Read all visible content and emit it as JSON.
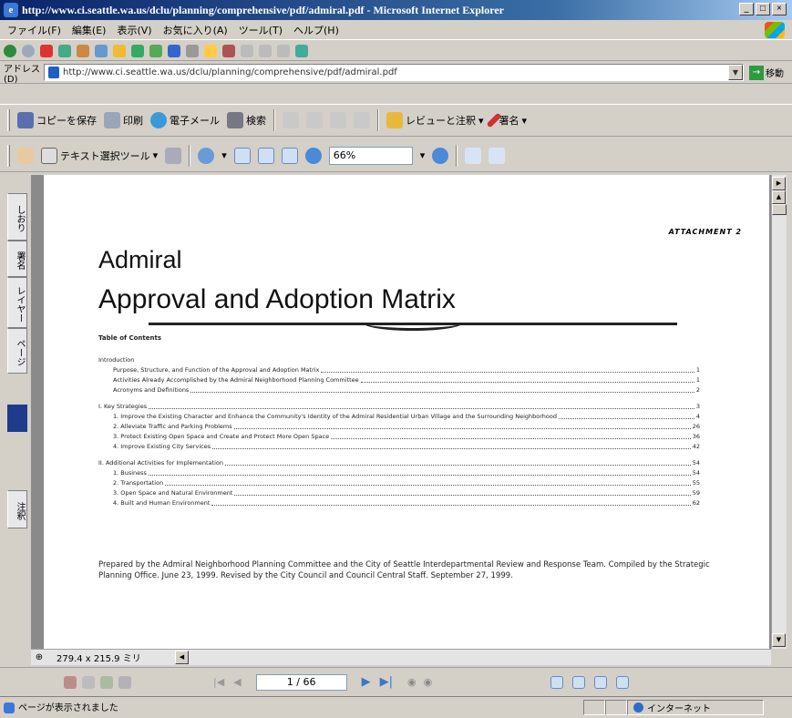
{
  "window": {
    "title": "http://www.ci.seattle.wa.us/dclu/planning/comprehensive/pdf/admiral.pdf - Microsoft Internet Explorer"
  },
  "menu": [
    "ファイル(F)",
    "編集(E)",
    "表示(V)",
    "お気に入り(A)",
    "ツール(T)",
    "ヘルプ(H)"
  ],
  "address": {
    "label": "アドレス(D)",
    "url": "http://www.ci.seattle.wa.us/dclu/planning/comprehensive/pdf/admiral.pdf",
    "go": "移動"
  },
  "toolbar1": {
    "save": "コピーを保存",
    "print": "印刷",
    "email": "電子メール",
    "search": "検索",
    "review": "レビューと注釈",
    "sign": "署名"
  },
  "toolbar2": {
    "select_text": "テキスト選択ツール",
    "zoom": "66%"
  },
  "side_tabs": {
    "bookmarks": "しおり",
    "signatures": "署名",
    "layers": "レイヤー",
    "pages": "ページ",
    "comments": "注釈"
  },
  "document": {
    "attachment": "ATTACHMENT 2",
    "title1": "Admiral",
    "title2": "Approval and Adoption Matrix",
    "toc_title": "Table of Contents",
    "intro": {
      "label": "Introduction",
      "items": [
        {
          "text": "Purpose, Structure, and Function of the Approval and Adoption Matrix",
          "page": "1"
        },
        {
          "text": "Activities Already Accomplished by the Admiral Neighborhood Planning Committee",
          "page": "1"
        },
        {
          "text": "Acronyms and Definitions",
          "page": "2"
        }
      ]
    },
    "key": {
      "label": "I. Key Strategies",
      "page": "3",
      "items": [
        {
          "text": "1. Improve the Existing Character and Enhance the Community's Identity of the Admiral Residential Urban Village and the Surrounding Neighborhood",
          "page": "4"
        },
        {
          "text": "2. Alleviate Traffic and Parking Problems",
          "page": "26"
        },
        {
          "text": "3. Protect Existing Open Space and Create and Protect More Open Space",
          "page": "36"
        },
        {
          "text": "4. Improve Existing City Services",
          "page": "42"
        }
      ]
    },
    "additional": {
      "label": "II. Additional Activities for Implementation",
      "page": "54",
      "items": [
        {
          "text": "1. Business",
          "page": "54"
        },
        {
          "text": "2. Transportation",
          "page": "55"
        },
        {
          "text": "3. Open Space and Natural Environment",
          "page": "59"
        },
        {
          "text": "4. Built and Human Environment",
          "page": "62"
        }
      ]
    },
    "prepared": "Prepared by the Admiral Neighborhood Planning Committee and the City of Seattle Interdepartmental Review and Response Team. Compiled by the Strategic Planning Office. June 23, 1999. Revised by the City Council and Council Central Staff. September 27, 1999."
  },
  "page_size": "279.4 x 215.9 ミリ",
  "nav": {
    "page": "1 / 66"
  },
  "status": {
    "text": "ページが表示されました",
    "zone": "インターネット"
  }
}
